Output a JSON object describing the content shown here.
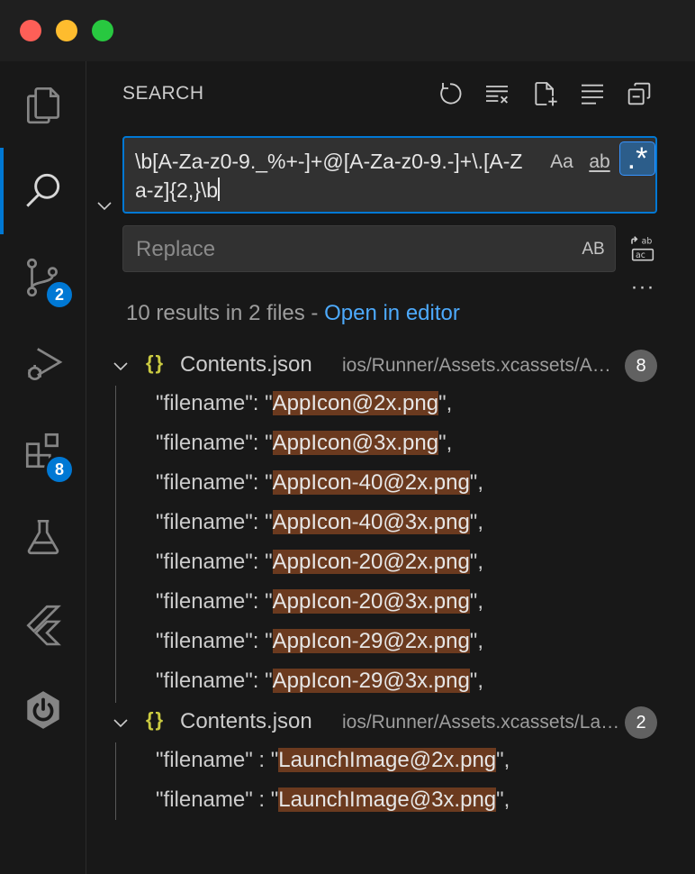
{
  "sidebar": {
    "title": "SEARCH",
    "search": {
      "query": "\\b[A-Za-z0-9._%+-]+@[A-Za-z0-9.-]+\\.[A-Za-z]{2,}\\b",
      "match_case_label": "Aa",
      "whole_word_label": "ab",
      "regex_label": ".*"
    },
    "replace": {
      "placeholder": "Replace",
      "preserve_case_label": "AB"
    },
    "more_label": "···",
    "summary": {
      "text": "10 results in 2 files - ",
      "link": "Open in editor"
    },
    "files": [
      {
        "icon": "{}",
        "name": "Contents.json",
        "path": "ios/Runner/Assets.xcassets/AppIcon.appiconset",
        "count": "8",
        "matches": [
          {
            "pre": "\"filename\": \"",
            "hit": "AppIcon@2x.png",
            "post": "\","
          },
          {
            "pre": "\"filename\": \"",
            "hit": "AppIcon@3x.png",
            "post": "\","
          },
          {
            "pre": "\"filename\": \"",
            "hit": "AppIcon-40@2x.png",
            "post": "\","
          },
          {
            "pre": "\"filename\": \"",
            "hit": "AppIcon-40@3x.png",
            "post": "\","
          },
          {
            "pre": "\"filename\": \"",
            "hit": "AppIcon-20@2x.png",
            "post": "\","
          },
          {
            "pre": "\"filename\": \"",
            "hit": "AppIcon-20@3x.png",
            "post": "\","
          },
          {
            "pre": "\"filename\": \"",
            "hit": "AppIcon-29@2x.png",
            "post": "\","
          },
          {
            "pre": "\"filename\": \"",
            "hit": "AppIcon-29@3x.png",
            "post": "\","
          }
        ]
      },
      {
        "icon": "{}",
        "name": "Contents.json",
        "path": "ios/Runner/Assets.xcassets/LaunchImage.imageset",
        "count": "2",
        "matches": [
          {
            "pre": "\"filename\" : \"",
            "hit": "LaunchImage@2x.png",
            "post": "\","
          },
          {
            "pre": "\"filename\" : \"",
            "hit": "LaunchImage@3x.png",
            "post": "\","
          }
        ]
      }
    ]
  },
  "activity_bar": {
    "source_control_badge": "2",
    "extensions_badge": "8"
  },
  "colors": {
    "accent": "#0078d4",
    "link": "#4daafc",
    "match_highlight": "#6b3a1f",
    "badge_gray": "#616161"
  },
  "icons": [
    "explorer-icon",
    "search-icon",
    "source-control-icon",
    "run-debug-icon",
    "extensions-icon",
    "testing-icon",
    "flutter-icon",
    "power-icon",
    "refresh-icon",
    "clear-results-icon",
    "new-search-editor-icon",
    "view-as-tree-icon",
    "collapse-all-icon",
    "chevron-down-icon",
    "replace-all-icon",
    "json-file-icon"
  ]
}
